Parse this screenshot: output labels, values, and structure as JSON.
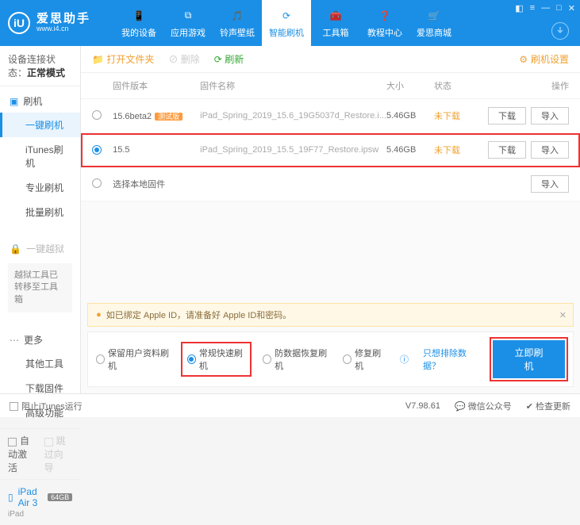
{
  "brand": {
    "name": "爱思助手",
    "url": "www.i4.cn"
  },
  "nav": [
    "我的设备",
    "应用游戏",
    "铃声壁纸",
    "智能刷机",
    "工具箱",
    "教程中心",
    "爱思商城"
  ],
  "nav_active": 3,
  "side": {
    "status_label": "设备连接状态：",
    "status_value": "正常模式",
    "g1_head": "刷机",
    "g1": [
      "一键刷机",
      "iTunes刷机",
      "专业刷机",
      "批量刷机"
    ],
    "g2_head": "一键越狱",
    "g2_note": "越狱工具已转移至工具箱",
    "g3_head": "更多",
    "g3": [
      "其他工具",
      "下载固件",
      "高级功能"
    ],
    "auto_activate": "自动激活",
    "skip_guide": "跳过向导"
  },
  "device": {
    "name": "iPad Air 3",
    "storage": "64GB",
    "type": "iPad"
  },
  "toolbar": {
    "open": "打开文件夹",
    "del": "删除",
    "refresh": "刷新",
    "settings": "刷机设置"
  },
  "cols": {
    "ver": "固件版本",
    "name": "固件名称",
    "size": "大小",
    "stat": "状态",
    "ops": "操作"
  },
  "rows": [
    {
      "ver": "15.6beta2",
      "tag": "测试版",
      "name": "iPad_Spring_2019_15.6_19G5037d_Restore.i...",
      "size": "5.46GB",
      "stat": "未下载",
      "sel": false
    },
    {
      "ver": "15.5",
      "tag": "",
      "name": "iPad_Spring_2019_15.5_19F77_Restore.ipsw",
      "size": "5.46GB",
      "stat": "未下载",
      "sel": true
    }
  ],
  "row_local": "选择本地固件",
  "btn": {
    "dl": "下载",
    "imp": "导入"
  },
  "warn": "如已绑定 Apple ID，请准备好 Apple ID和密码。",
  "modes": [
    "保留用户资料刷机",
    "常规快速刷机",
    "防数据恢复刷机",
    "修复刷机"
  ],
  "mode_sel": 1,
  "exclude_link": "只想排除数据？",
  "flash_now": "立即刷机",
  "footer": {
    "block": "阻止iTunes运行",
    "ver": "V7.98.61",
    "wx": "微信公众号",
    "upd": "检查更新"
  }
}
